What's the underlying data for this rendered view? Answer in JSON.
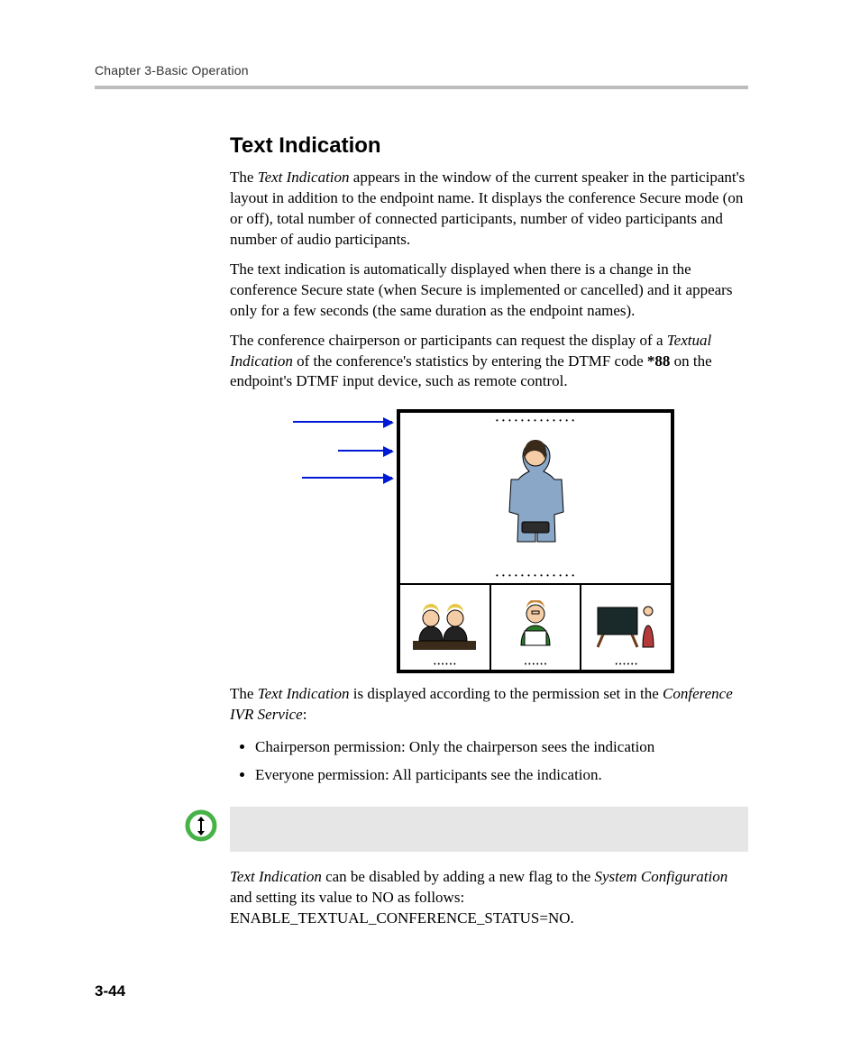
{
  "header": {
    "chapter_line": "Chapter 3-Basic Operation"
  },
  "section": {
    "title": "Text Indication"
  },
  "paragraphs": {
    "p1_prefix": "The ",
    "p1_em": "Text Indication",
    "p1_rest": " appears in the window of the current speaker in the participant's layout in addition to the endpoint name. It displays the conference Secure mode (on or off), total number of connected participants, number of video participants and number of audio participants.",
    "p2": "The text indication is automatically displayed when there is a change in the conference Secure state (when Secure is implemented or cancelled) and it appears only for a few seconds (the same duration as the endpoint names).",
    "p3_pre": "The conference chairperson or participants can request the display of a ",
    "p3_em": "Textual Indication",
    "p3_mid": " of the conference's statistics by entering the DTMF code ",
    "p3_bold": "*88",
    "p3_post": " on the endpoint's DTMF input device, such as remote control.",
    "p4_pre": "The ",
    "p4_em": "Text Indication",
    "p4_mid": " is displayed according to the permission set in the ",
    "p4_em2": "Conference IVR Service",
    "p4_post": ":",
    "p5_em": "Text Indication",
    "p5_mid": " can be disabled by adding a new flag to the ",
    "p5_em2": "System Configuration",
    "p5_post": " and setting its value to NO as follows: ENABLE_TEXTUAL_CONFERENCE_STATUS=NO."
  },
  "bullets": {
    "b1": "Chairperson permission: Only the chairperson sees the indication",
    "b2": "Everyone permission: All participants see the indication."
  },
  "note": {
    "text": ""
  },
  "page_number": "3-44"
}
